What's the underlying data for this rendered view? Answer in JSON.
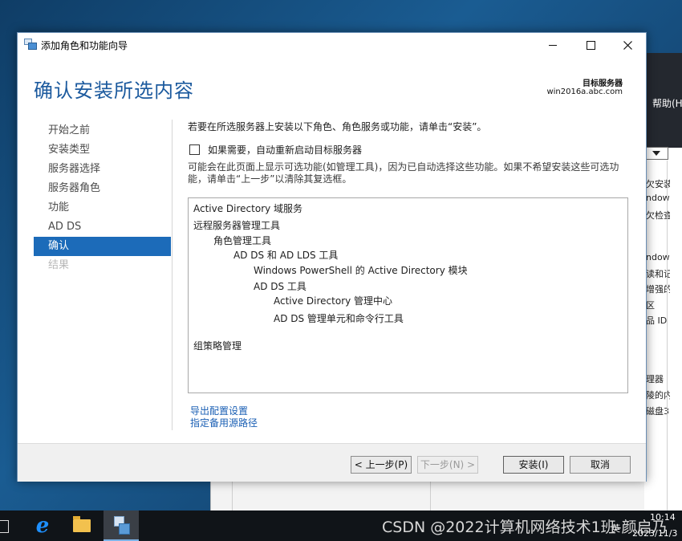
{
  "dialog": {
    "title": "添加角色和功能向导",
    "page_title": "确认安装所选内容",
    "target_server_label": "目标服务器",
    "target_server_value": "win2016a.abc.com"
  },
  "nav": {
    "items": [
      {
        "label": "开始之前",
        "state": "normal"
      },
      {
        "label": "安装类型",
        "state": "normal"
      },
      {
        "label": "服务器选择",
        "state": "normal"
      },
      {
        "label": "服务器角色",
        "state": "normal"
      },
      {
        "label": "功能",
        "state": "normal"
      },
      {
        "label": "AD DS",
        "state": "normal"
      },
      {
        "label": "确认",
        "state": "active"
      },
      {
        "label": "结果",
        "state": "disabled"
      }
    ]
  },
  "content": {
    "intro": "若要在所选服务器上安装以下角色、角色服务或功能，请单击“安装”。",
    "restart_checkbox_label": "如果需要，自动重新启动目标服务器",
    "restart_checked": false,
    "note": "可能会在此页面上显示可选功能(如管理工具)，因为已自动选择这些功能。如果不希望安装这些可选功能，请单击“上一步”以清除其复选框。",
    "features": [
      {
        "label": "Active Directory 域服务",
        "level": 0
      },
      {
        "label": "远程服务器管理工具",
        "level": 0
      },
      {
        "label": "角色管理工具",
        "level": 1
      },
      {
        "label": "AD DS 和 AD LDS 工具",
        "level": 2
      },
      {
        "label": "Windows PowerShell 的 Active Directory 模块",
        "level": 3
      },
      {
        "label": "AD DS 工具",
        "level": 3
      },
      {
        "label": "Active Directory 管理中心",
        "level": 4
      },
      {
        "label": "AD DS 管理单元和命令行工具",
        "level": 4
      },
      {
        "label": "组策略管理",
        "level": 0
      }
    ],
    "links": {
      "export": "导出配置设置",
      "alternate_source": "指定备用源路径"
    }
  },
  "footer": {
    "back": "< 上一步(P)",
    "next": "下一步(N) >",
    "install": "安装(I)",
    "cancel": "取消"
  },
  "background_window": {
    "help_menu": "帮助(H",
    "side_texts": [
      "欠安装",
      "ndow",
      "欠检查",
      "ndow",
      "读和记",
      "增强的",
      "区",
      "品 ID",
      "理器",
      "陵的内",
      "磁盘3"
    ]
  },
  "taskbar": {
    "watermark": "CSDN @2022计算机网络技术1班-颜启乃",
    "tray_time": "10:14",
    "tray_lang": "英",
    "tray_date": "2023/11/3"
  },
  "colors": {
    "accent": "#1c6bb9",
    "title_blue": "#1c5a9e",
    "link": "#1a5fb4"
  }
}
